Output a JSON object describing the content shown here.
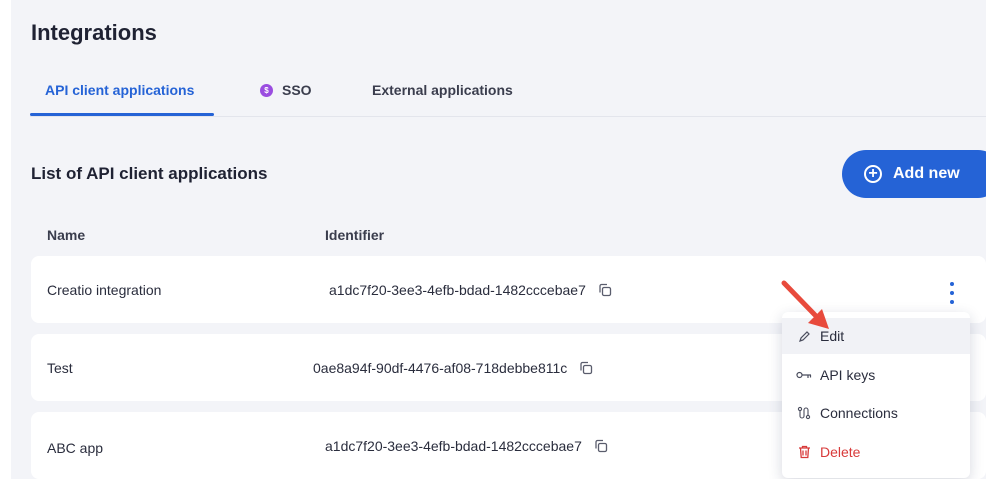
{
  "page": {
    "title": "Integrations"
  },
  "tabs": [
    {
      "label": "API client applications",
      "active": true
    },
    {
      "label": "SSO",
      "badge": "$"
    },
    {
      "label": "External applications"
    }
  ],
  "section": {
    "title": "List of API client applications",
    "add_button": "Add new"
  },
  "table": {
    "columns": [
      "Name",
      "Identifier"
    ],
    "rows": [
      {
        "name": "Creatio integration",
        "identifier": "a1dc7f20-3ee3-4efb-bdad-1482cccebae7"
      },
      {
        "name": "Test",
        "identifier": "0ae8a94f-90df-4476-af08-718debbe811c"
      },
      {
        "name": "ABC app",
        "identifier": "a1dc7f20-3ee3-4efb-bdad-1482cccebae7"
      }
    ]
  },
  "menu": {
    "items": [
      {
        "label": "Edit",
        "icon": "pencil-icon"
      },
      {
        "label": "API keys",
        "icon": "key-icon"
      },
      {
        "label": "Connections",
        "icon": "connections-icon"
      },
      {
        "label": "Delete",
        "icon": "trash-icon"
      }
    ]
  },
  "colors": {
    "accent": "#2563d6",
    "danger": "#d83a3a",
    "sso_badge": "#9a4de0",
    "arrow": "#e84a3c"
  }
}
